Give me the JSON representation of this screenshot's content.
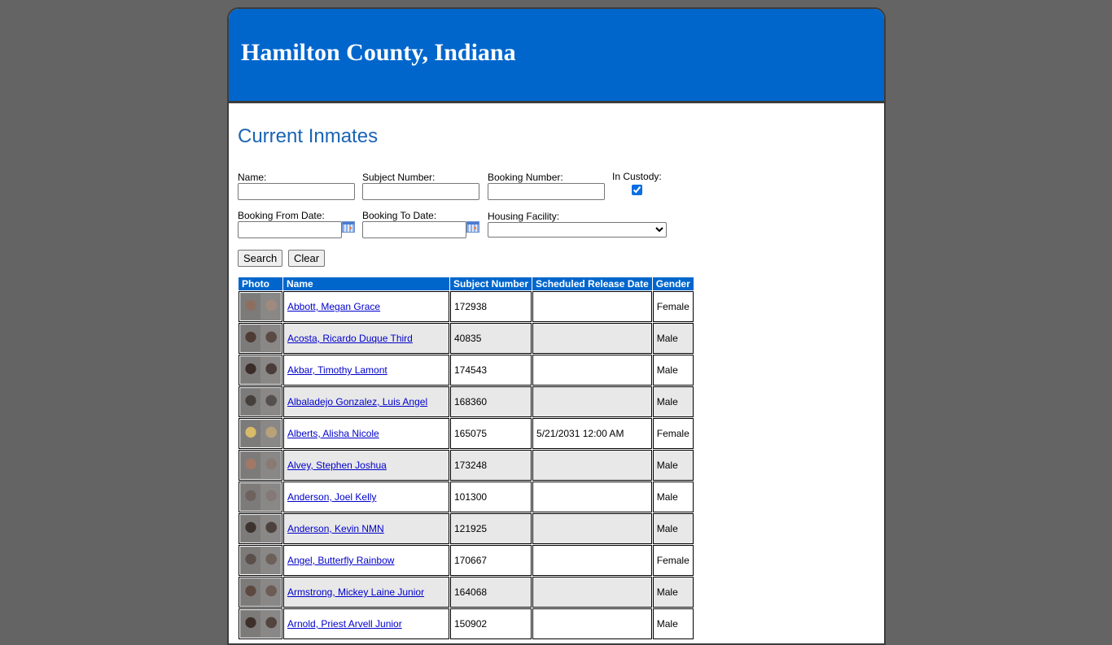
{
  "header": {
    "title": "Hamilton County, Indiana"
  },
  "page_title": "Current Inmates",
  "search_form": {
    "name_label": "Name:",
    "name_value": "",
    "subject_number_label": "Subject Number:",
    "subject_number_value": "",
    "booking_number_label": "Booking Number:",
    "booking_number_value": "",
    "in_custody_label": "In Custody:",
    "in_custody_checked": true,
    "booking_from_label": "Booking From Date:",
    "booking_from_value": "",
    "booking_to_label": "Booking To Date:",
    "booking_to_value": "",
    "housing_facility_label": "Housing Facility:",
    "housing_facility_selected": "",
    "search_button": "Search",
    "clear_button": "Clear",
    "calendar_icon": "calendar-icon"
  },
  "table": {
    "columns": [
      "Photo",
      "Name",
      "Subject Number",
      "Scheduled Release Date",
      "Gender"
    ],
    "rows": [
      {
        "name": "Abbott, Megan Grace",
        "subject_number": "172938",
        "release_date": "",
        "gender": "Female",
        "photo_tone": [
          "#8d6f60",
          "#a08a7e"
        ]
      },
      {
        "name": "Acosta, Ricardo Duque Third",
        "subject_number": "40835",
        "release_date": "",
        "gender": "Male",
        "photo_tone": [
          "#4e3b34",
          "#5a4a44"
        ]
      },
      {
        "name": "Akbar, Timothy Lamont",
        "subject_number": "174543",
        "release_date": "",
        "gender": "Male",
        "photo_tone": [
          "#3a2c28",
          "#4a3d39"
        ]
      },
      {
        "name": "Albaladejo Gonzalez, Luis Angel",
        "subject_number": "168360",
        "release_date": "",
        "gender": "Male",
        "photo_tone": [
          "#46403d",
          "#55504d"
        ]
      },
      {
        "name": "Alberts, Alisha Nicole",
        "subject_number": "165075",
        "release_date": "5/21/2031 12:00 AM",
        "gender": "Female",
        "photo_tone": [
          "#d8bb6a",
          "#b7a27a"
        ]
      },
      {
        "name": "Alvey, Stephen Joshua",
        "subject_number": "173248",
        "release_date": "",
        "gender": "Male",
        "photo_tone": [
          "#a07866",
          "#8a7a74"
        ]
      },
      {
        "name": "Anderson, Joel Kelly",
        "subject_number": "101300",
        "release_date": "",
        "gender": "Male",
        "photo_tone": [
          "#6e625e",
          "#837a77"
        ]
      },
      {
        "name": "Anderson, Kevin NMN",
        "subject_number": "121925",
        "release_date": "",
        "gender": "Male",
        "photo_tone": [
          "#3c322e",
          "#4b413d"
        ]
      },
      {
        "name": "Angel, Butterfly Rainbow",
        "subject_number": "170667",
        "release_date": "",
        "gender": "Female",
        "photo_tone": [
          "#5a4f4b",
          "#6b605a"
        ]
      },
      {
        "name": "Armstrong, Mickey Laine Junior",
        "subject_number": "164068",
        "release_date": "",
        "gender": "Male",
        "photo_tone": [
          "#5d4840",
          "#6d5c55"
        ]
      },
      {
        "name": "Arnold, Priest Arvell Junior",
        "subject_number": "150902",
        "release_date": "",
        "gender": "Male",
        "photo_tone": [
          "#3d302b",
          "#52443f"
        ]
      }
    ]
  }
}
